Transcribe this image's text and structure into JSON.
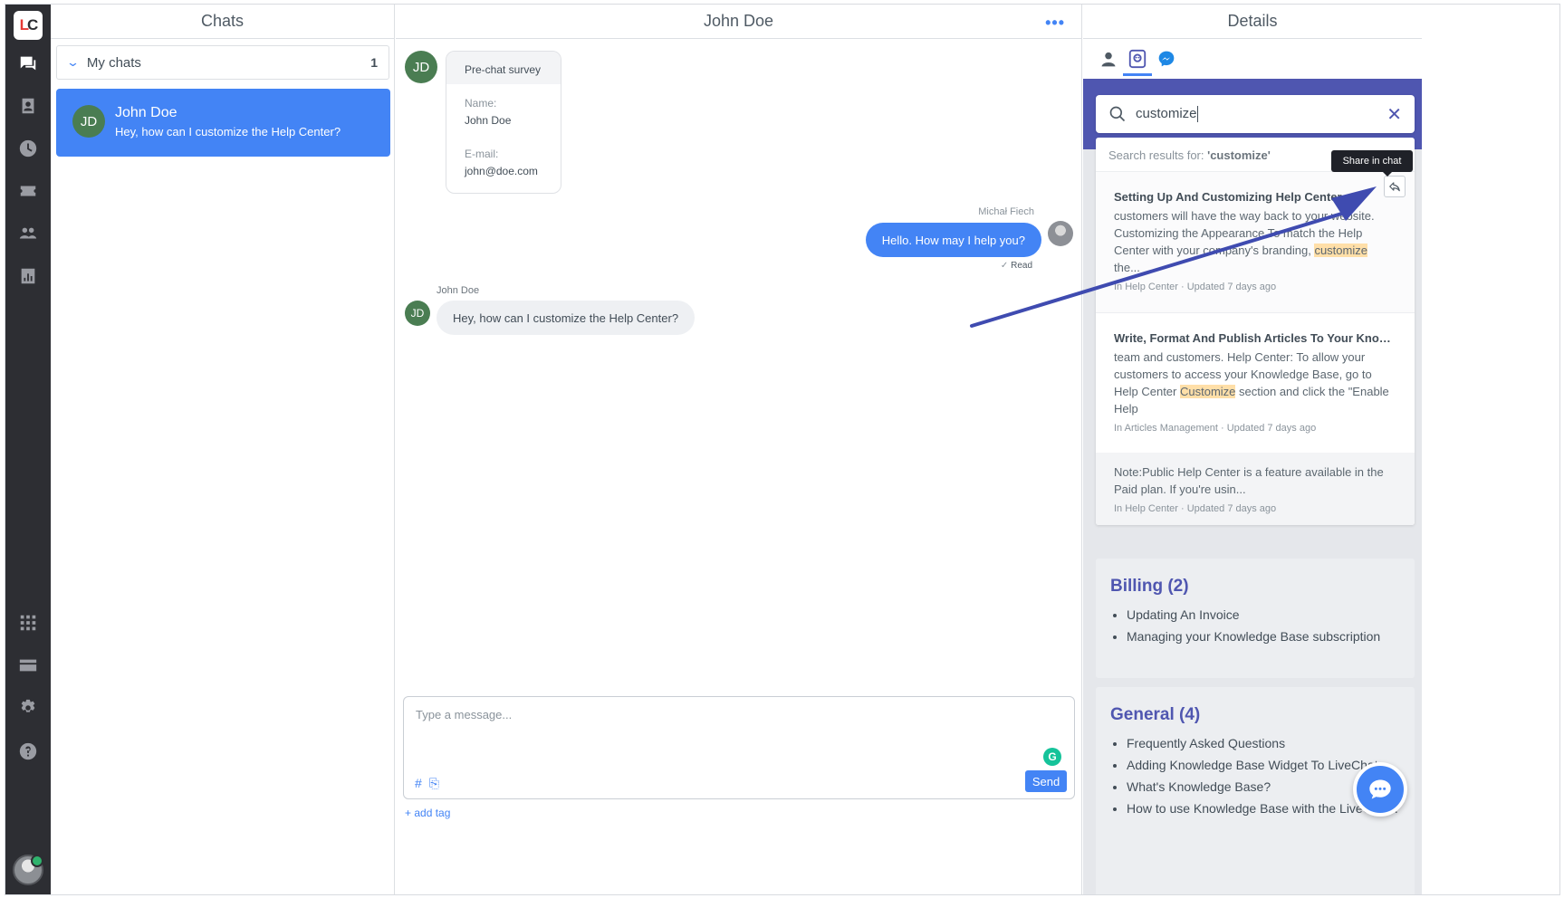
{
  "logo": {
    "text_l": "L",
    "text_c": "C"
  },
  "chats_panel": {
    "title": "Chats",
    "group_label": "My chats",
    "group_count": "1",
    "active_chat": {
      "initials": "JD",
      "name": "John Doe",
      "preview": "Hey, how can I customize the Help Center?"
    }
  },
  "conversation": {
    "title": "John Doe",
    "menu_icon": "more-dots-icon",
    "survey": {
      "initials": "JD",
      "title": "Pre-chat survey",
      "name_label": "Name:",
      "name_value": "John Doe",
      "email_label": "E-mail:",
      "email_value": "john@doe.com"
    },
    "agent_message": {
      "sender": "Michał Fiech",
      "text": "Hello. How may I help you?",
      "status": "Read",
      "status_icon": "✓"
    },
    "visitor_message": {
      "sender": "John Doe",
      "initials": "JD",
      "text": "Hey, how can I customize the Help Center?"
    },
    "composer": {
      "placeholder": "Type a message...",
      "hash": "#",
      "attach": "⎘",
      "send_label": "Send",
      "grammarly": "G",
      "add_tag": "+ add tag"
    }
  },
  "details": {
    "title": "Details",
    "search": {
      "query": "customize"
    },
    "results_header_prefix": "Search results for: ",
    "results_header_query": "'customize'",
    "tooltip": "Share in chat",
    "results": [
      {
        "title": "Setting Up And Customizing Help Center",
        "body_a": "customers will have the way back to your website. Customizing the Appearance To match the Help Center with your company's branding, ",
        "highlight": "customize",
        "body_b": " the...",
        "meta": "In Help Center · Updated 7 days ago"
      },
      {
        "title": "Write, Format And Publish Articles To Your Knowledge Base",
        "body_a": "team and customers. Help Center: To allow your customers to access your Knowledge Base, go to Help Center ",
        "highlight": "Customize",
        "body_b": " section and click the \"Enable Help",
        "meta": "In Articles Management · Updated 7 days ago"
      },
      {
        "body": "Note:Public Help Center is a feature available in the Paid plan. If you're usin...",
        "meta": "In Help Center · Updated 7 days ago"
      }
    ],
    "categories": [
      {
        "title": "Billing (2)",
        "items": [
          "Updating An Invoice",
          "Managing your Knowledge Base subscription"
        ]
      },
      {
        "title": "General (4)",
        "items": [
          "Frequently Asked Questions",
          "Adding Knowledge Base Widget To LiveChat",
          "What's Knowledge Base?",
          "How to use Knowledge Base with the LiveChat app"
        ]
      }
    ]
  },
  "colors": {
    "accent": "#4384f5",
    "kb_brand": "#4f56b0",
    "arrow": "#3f4bb0",
    "rail": "#2d2e33"
  }
}
